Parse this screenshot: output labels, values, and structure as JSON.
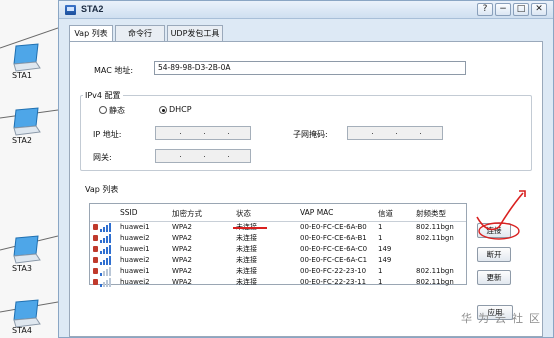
{
  "stations": [
    {
      "label": "STA1"
    },
    {
      "label": "STA2"
    },
    {
      "label": "STA3"
    },
    {
      "label": "STA4"
    }
  ],
  "window": {
    "title": "STA2",
    "controls": {
      "help": "?",
      "minimize": "−",
      "maximize": "□",
      "close": "✕"
    }
  },
  "tabs": [
    {
      "label": "Vap 列表",
      "active": true
    },
    {
      "label": "命令行",
      "active": false
    },
    {
      "label": "UDP发包工具",
      "active": false
    }
  ],
  "form": {
    "mac_label": "MAC 地址:",
    "mac_value": "54-89-98-D3-2B-0A",
    "ipv4_group": "IPv4 配置",
    "static_label": "静态",
    "dhcp_label": "DHCP",
    "dhcp_selected": true,
    "ip_label": "IP 地址:",
    "mask_label": "子网掩码:",
    "gateway_label": "网关:"
  },
  "vap": {
    "group_title": "Vap 列表",
    "columns": [
      "SSID",
      "加密方式",
      "状态",
      "VAP MAC",
      "信道",
      "射频类型"
    ],
    "rows": [
      {
        "ssid": "huawei1",
        "enc": "WPA2",
        "status": "未连接",
        "mac": "00-E0-FC-CE-6A-B0",
        "channel": "1",
        "radio": "802.11bgn",
        "signal": 4
      },
      {
        "ssid": "huawei2",
        "enc": "WPA2",
        "status": "未连接",
        "mac": "00-E0-FC-CE-6A-B1",
        "channel": "1",
        "radio": "802.11bgn",
        "signal": 4
      },
      {
        "ssid": "huawei1",
        "enc": "WPA2",
        "status": "未连接",
        "mac": "00-E0-FC-CE-6A-C0",
        "channel": "149",
        "radio": "",
        "signal": 4
      },
      {
        "ssid": "huawei2",
        "enc": "WPA2",
        "status": "未连接",
        "mac": "00-E0-FC-CE-6A-C1",
        "channel": "149",
        "radio": "",
        "signal": 4
      },
      {
        "ssid": "huawei1",
        "enc": "WPA2",
        "status": "未连接",
        "mac": "00-E0-FC-22-23-10",
        "channel": "1",
        "radio": "802.11bgn",
        "signal": 1
      },
      {
        "ssid": "huawei2",
        "enc": "WPA2",
        "status": "未连接",
        "mac": "00-E0-FC-22-23-11",
        "channel": "1",
        "radio": "802.11bgn",
        "signal": 1
      }
    ]
  },
  "buttons": {
    "connect": "连接",
    "disconnect": "断开",
    "refresh": "更新",
    "apply": "应用"
  },
  "watermark": "华为云社区",
  "colors": {
    "annotation_red": "#d9201f",
    "signal_blue": "#2f6fd0"
  }
}
